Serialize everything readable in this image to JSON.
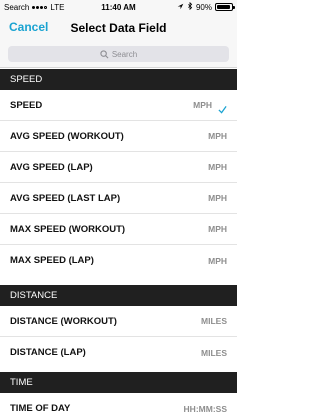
{
  "status_bar": {
    "carrier_back": "Search",
    "network": "LTE",
    "time": "11:40 AM",
    "battery_percent": "90%",
    "battery_level": 0.9
  },
  "nav": {
    "cancel_label": "Cancel",
    "title": "Select Data Field"
  },
  "search": {
    "placeholder": "Search"
  },
  "sections": [
    {
      "header": "SPEED",
      "rows": [
        {
          "label": "SPEED",
          "unit": "MPH",
          "selected": true
        },
        {
          "label": "AVG SPEED (WORKOUT)",
          "unit": "MPH",
          "selected": false
        },
        {
          "label": "AVG SPEED (LAP)",
          "unit": "MPH",
          "selected": false
        },
        {
          "label": "AVG SPEED (LAST LAP)",
          "unit": "MPH",
          "selected": false
        },
        {
          "label": "MAX SPEED (WORKOUT)",
          "unit": "MPH",
          "selected": false
        },
        {
          "label": "MAX SPEED (LAP)",
          "unit": "MPH",
          "selected": false
        }
      ]
    },
    {
      "header": "DISTANCE",
      "rows": [
        {
          "label": "DISTANCE (WORKOUT)",
          "unit": "MILES",
          "selected": false
        },
        {
          "label": "DISTANCE (LAP)",
          "unit": "MILES",
          "selected": false
        }
      ]
    },
    {
      "header": "TIME",
      "rows": [
        {
          "label": "TIME OF DAY",
          "unit": "HH:MM:SS",
          "selected": false
        }
      ]
    }
  ],
  "colors": {
    "accent": "#1aa3d1",
    "section_header_bg": "#202020"
  }
}
